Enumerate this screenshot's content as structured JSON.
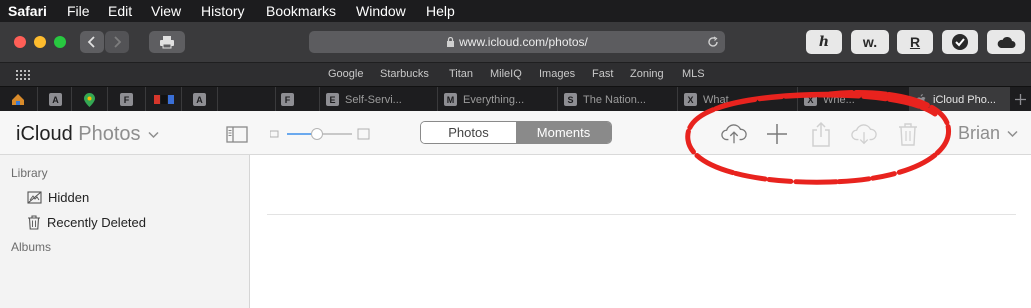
{
  "menubar": {
    "app": "Safari",
    "items": [
      "File",
      "Edit",
      "View",
      "History",
      "Bookmarks",
      "Window",
      "Help"
    ]
  },
  "toolbar": {
    "url": "www.icloud.com/photos/",
    "extensions": [
      "h",
      "w.",
      "R",
      "✓",
      "cloud"
    ]
  },
  "favorites": [
    "Google",
    "Starbucks",
    "Titan",
    "MileIQ",
    "Images",
    "Fast",
    "Zoning",
    "MLS"
  ],
  "tabs": [
    {
      "icon": "F",
      "label": ""
    },
    {
      "icon": "E",
      "label": "Self-Servi..."
    },
    {
      "icon": "M",
      "label": "Everything..."
    },
    {
      "icon": "S",
      "label": "The Nation..."
    },
    {
      "icon": "X",
      "label": "What..."
    },
    {
      "icon": "X",
      "label": "Whe..."
    },
    {
      "icon": "",
      "label": "iCloud Pho..."
    }
  ],
  "pinned_tabs": [
    "A",
    "A",
    "F",
    "A"
  ],
  "header": {
    "brand": "iCloud",
    "section": "Photos",
    "segments": [
      "Photos",
      "Moments"
    ],
    "selected_segment": "Moments",
    "user": "Brian"
  },
  "sidebar": {
    "library_heading": "Library",
    "items": [
      "Hidden",
      "Recently Deleted"
    ],
    "albums_heading": "Albums"
  },
  "colors": {
    "annotation": "#e8231e",
    "segment_selected": "#8a8a8a",
    "toolbar": "#3a3a3c",
    "menubar": "#1c1c1e"
  }
}
